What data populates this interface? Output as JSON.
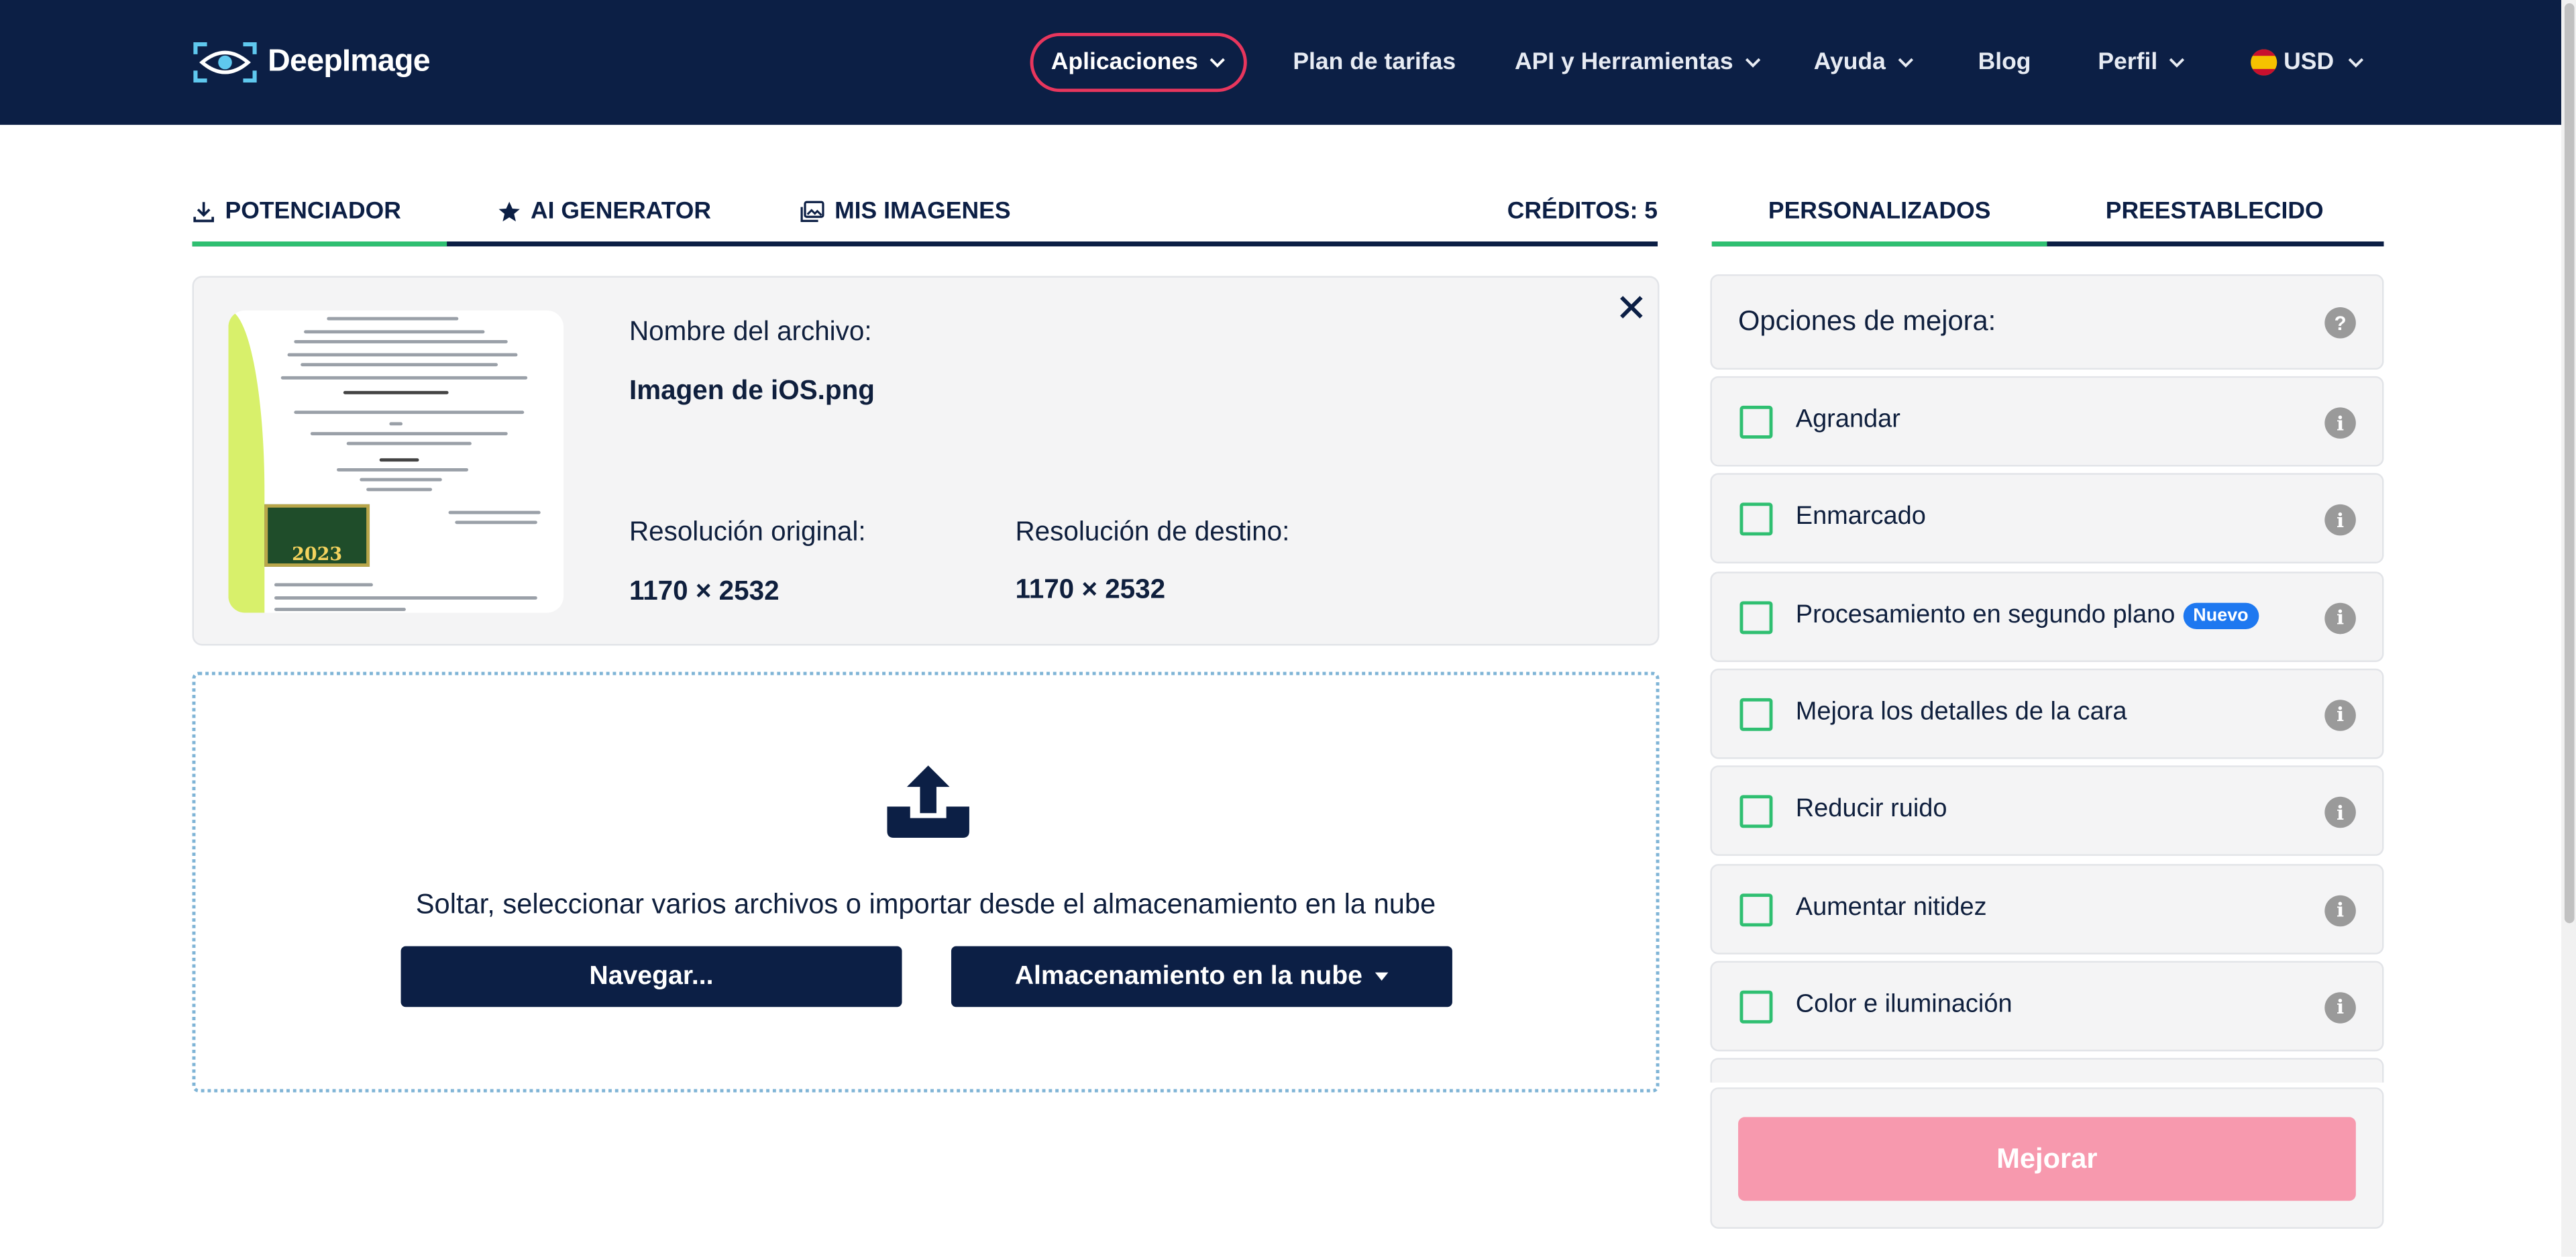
{
  "brand": {
    "name": "DeepImage"
  },
  "nav": {
    "apps": "Aplicaciones",
    "pricing": "Plan de tarifas",
    "api": "API y Herramientas",
    "help": "Ayuda",
    "blog": "Blog",
    "profile": "Perfil",
    "currency": "USD"
  },
  "tabs": {
    "enhancer": "POTENCIADOR",
    "ai_generator": "AI GENERATOR",
    "my_images": "MIS IMAGENES",
    "credits": "CRÉDITOS: 5",
    "active": "POTENCIADOR"
  },
  "file": {
    "name_label": "Nombre del archivo:",
    "name_value": "Imagen de iOS.png",
    "orig_res_label": "Resolución original:",
    "orig_res_value": "1170 × 2532",
    "target_res_label": "Resolución de destino:",
    "target_res_value": "1170 × 2532",
    "thumb_year": "2023"
  },
  "upload": {
    "text": "Soltar, seleccionar varios archivos o importar desde el almacenamiento en la nube",
    "browse": "Navegar...",
    "cloud": "Almacenamiento en la nube"
  },
  "panel": {
    "tab_custom": "PERSONALIZADOS",
    "tab_preset": "PREESTABLECIDO",
    "active_tab": "PERSONALIZADOS",
    "options_title": "Opciones de mejora:",
    "help_glyph": "?",
    "info_glyph": "i",
    "options": [
      {
        "label": "Agrandar",
        "checked": false
      },
      {
        "label": "Enmarcado",
        "checked": false
      },
      {
        "label": "Procesamiento en segundo plano",
        "badge": "Nuevo",
        "checked": false
      },
      {
        "label": "Mejora los detalles de la cara",
        "checked": false
      },
      {
        "label": "Reducir ruido",
        "checked": false
      },
      {
        "label": "Aumentar nitidez",
        "checked": false
      },
      {
        "label": "Color e iluminación",
        "checked": false
      }
    ],
    "improve": "Mejorar"
  },
  "colors": {
    "navy": "#0c1f45",
    "accent_green": "#2fbf71",
    "accent_red": "#e8365d",
    "improve_pink": "#f799ae",
    "badge_blue": "#1e78f0"
  }
}
